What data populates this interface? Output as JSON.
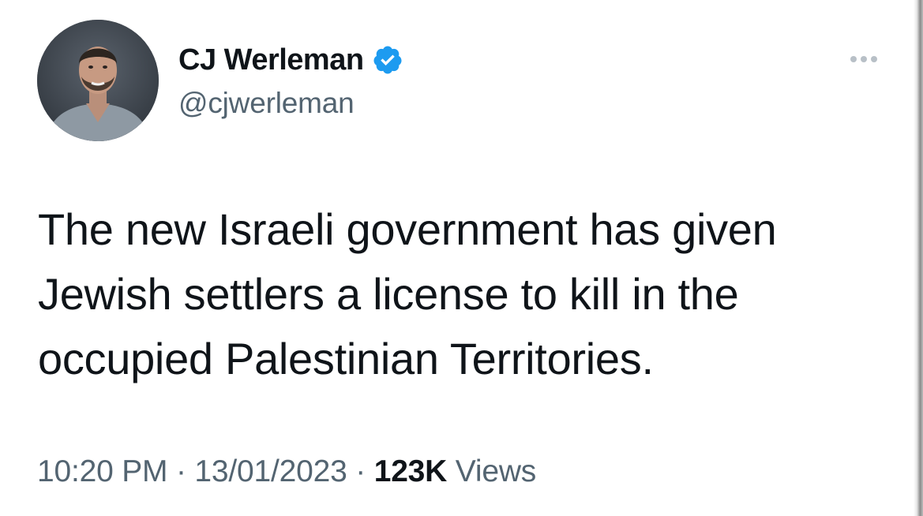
{
  "author": {
    "display_name": "CJ Werleman",
    "handle": "@cjwerleman",
    "verified": true
  },
  "tweet": {
    "text_lines": [
      "The new Israeli government has given",
      "Jewish settlers a license to kill in the",
      "occupied Palestinian Territories."
    ],
    "time": "10:20 PM",
    "date": "13/01/2023",
    "separator": "·",
    "views_count": "123K",
    "views_label": "Views"
  },
  "icons": {
    "verified": "verified-badge-icon",
    "more": "more-horizontal-icon"
  },
  "colors": {
    "verified_blue": "#1d9bf0",
    "secondary_text": "#536471",
    "primary_text": "#0f1419"
  }
}
